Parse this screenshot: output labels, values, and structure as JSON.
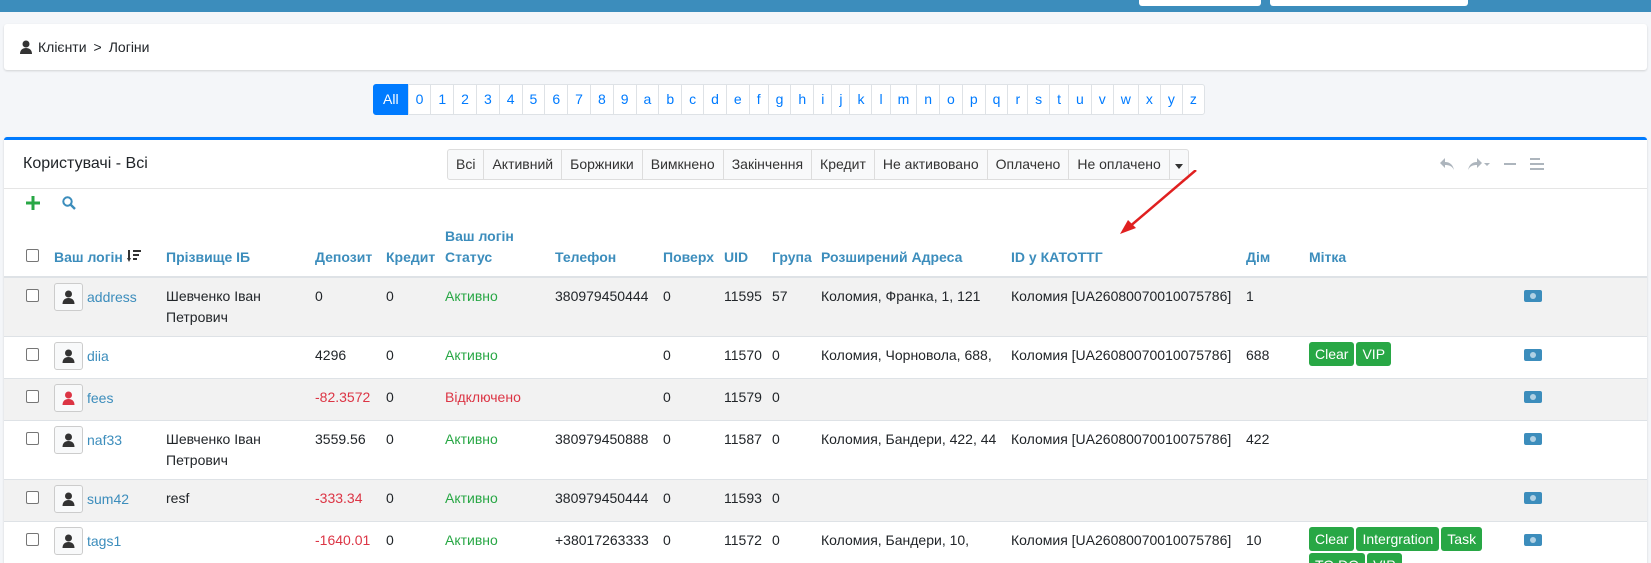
{
  "breadcrumb": {
    "clients": "Клієнти",
    "separator": ">",
    "logins": "Логіни"
  },
  "alphabet": [
    "All",
    "0",
    "1",
    "2",
    "3",
    "4",
    "5",
    "6",
    "7",
    "8",
    "9",
    "a",
    "b",
    "c",
    "d",
    "e",
    "f",
    "g",
    "h",
    "i",
    "j",
    "k",
    "l",
    "m",
    "n",
    "o",
    "p",
    "q",
    "r",
    "s",
    "t",
    "u",
    "v",
    "w",
    "x",
    "y",
    "z"
  ],
  "card": {
    "title": "Користувачі - Всі"
  },
  "filters": [
    "Всі",
    "Активний",
    "Боржники",
    "Вимкнено",
    "Закінчення",
    "Кредит",
    "Не активовано",
    "Оплачено",
    "Не оплачено"
  ],
  "columns": {
    "login": "Ваш логін",
    "fio": "Прізвище ІБ",
    "deposit": "Депозит",
    "credit": "Кредит",
    "status_l1": "Ваш логін",
    "status_l2": "Статус",
    "phone": "Телефон",
    "floor": "Поверх",
    "uid": "UID",
    "group": "Група",
    "address": "Розширений Адреса",
    "katottg": "ID у КАТОТТГ",
    "house": "Дім",
    "tags": "Мітка"
  },
  "rows": [
    {
      "login": "address",
      "fio": "Шевченко Іван Петрович",
      "deposit": "0",
      "credit": "0",
      "status": "Активно",
      "phone": "380979450444",
      "floor": "0",
      "uid": "11595",
      "group": "57",
      "address": "Коломия, Франка, 1, 121",
      "katottg": "Коломия [UA26080070010075786]",
      "house": "1",
      "tags": []
    },
    {
      "login": "diia",
      "fio": "",
      "deposit": "4296",
      "credit": "0",
      "status": "Активно",
      "phone": "",
      "floor": "0",
      "uid": "11570",
      "group": "0",
      "address": "Коломия, Чорновола, 688,",
      "katottg": "Коломия [UA26080070010075786]",
      "house": "688",
      "tags": [
        "Clear",
        "VIP"
      ]
    },
    {
      "login": "fees",
      "fio": "",
      "deposit": "-82.3572",
      "credit": "0",
      "status": "Відключено",
      "phone": "",
      "floor": "0",
      "uid": "11579",
      "group": "0",
      "address": "",
      "katottg": "",
      "house": "",
      "tags": []
    },
    {
      "login": "naf33",
      "fio": "Шевченко Іван Петрович",
      "deposit": "3559.56",
      "credit": "0",
      "status": "Активно",
      "phone": "380979450888",
      "floor": "0",
      "uid": "11587",
      "group": "0",
      "address": "Коломия, Бандери, 422, 44",
      "katottg": "Коломия [UA26080070010075786]",
      "house": "422",
      "tags": []
    },
    {
      "login": "sum42",
      "fio": "resf",
      "deposit": "-333.34",
      "credit": "0",
      "status": "Активно",
      "phone": "380979450444",
      "floor": "0",
      "uid": "11593",
      "group": "0",
      "address": "",
      "katottg": "",
      "house": "",
      "tags": []
    },
    {
      "login": "tags1",
      "fio": "",
      "deposit": "-1640.01",
      "credit": "0",
      "status": "Активно",
      "phone": "+38017263333",
      "floor": "0",
      "uid": "11572",
      "group": "0",
      "address": "Коломия, Бандери, 10,",
      "katottg": "Коломия [UA26080070010075786]",
      "house": "10",
      "tags": [
        "Clear",
        "Intergration",
        "Task",
        "TO DO",
        "VIP"
      ]
    }
  ],
  "colors": {
    "accent": "#3c8dbc",
    "primary": "#007bff",
    "success": "#28a745",
    "danger": "#dc3545"
  },
  "icons": {
    "user": "user-icon",
    "add": "plus-icon",
    "search": "search-icon",
    "undo": "undo-icon",
    "redo": "redo-icon",
    "minimize": "minus-icon",
    "menu": "menu-icon",
    "sort": "sort-icon",
    "payment": "money-icon",
    "annotation": "red-arrow"
  }
}
